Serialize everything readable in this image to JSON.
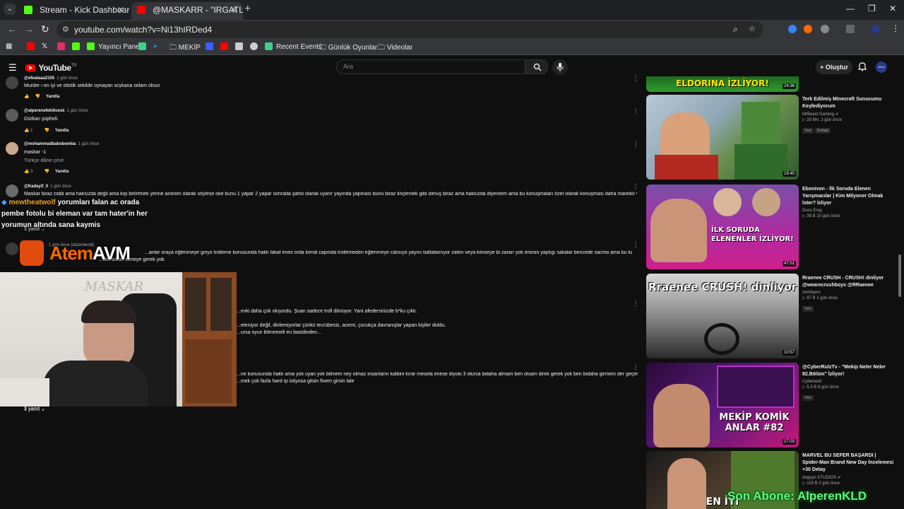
{
  "browser": {
    "tabs": [
      {
        "title": "Stream - Kick Dashboard",
        "active": false,
        "favicon_color": "#53fc18"
      },
      {
        "title": "@MASKARR - \"IRGATLARIN GÜ",
        "active": true,
        "favicon_color": "#ff0000"
      }
    ],
    "url": "youtube.com/watch?v=Ni13hIRDed4",
    "bookmarks": [
      {
        "label": "",
        "icon": "youtube-icon",
        "color": "#ff0000"
      },
      {
        "label": "",
        "icon": "x-icon",
        "color": "#ffffff"
      },
      {
        "label": "",
        "icon": "instagram-icon",
        "color": "#e1306c"
      },
      {
        "label": "Yayıncı Paneli",
        "icon": "kick-icon",
        "color": "#53fc18"
      },
      {
        "label": "",
        "icon": "app-icon",
        "color": "#3ecf8e"
      },
      {
        "label": "",
        "icon": "prime-icon",
        "color": "#3a7bd5"
      },
      {
        "label": "MEKİP",
        "icon": "folder-icon",
        "color": "#aaaaaa"
      },
      {
        "label": "",
        "icon": "bookmark-icon",
        "color": "#3b5cff"
      },
      {
        "label": "",
        "icon": "youtube-icon",
        "color": "#ff0000"
      },
      {
        "label": "",
        "icon": "image-icon",
        "color": "#cccccc"
      },
      {
        "label": "",
        "icon": "circle-icon",
        "color": "#cccccc"
      },
      {
        "label": "Recent Events",
        "icon": "events-icon",
        "color": "#3ecf8e"
      },
      {
        "label": "Günlük Oyunlar",
        "icon": "folder-icon",
        "color": "#aaaaaa"
      },
      {
        "label": "Videolar",
        "icon": "folder-icon",
        "color": "#aaaaaa"
      }
    ]
  },
  "youtube": {
    "logo_text": "YouTube",
    "logo_country": "TR",
    "search_placeholder": "Ara",
    "create_label": "Oluştur",
    "avatar_text": "Ahoo"
  },
  "comments": [
    {
      "handle": "@efeataaa2105",
      "time": "1 gün önce",
      "text": "Murder ı en iyi ve otistik sekilde oynayan scykana selam olsun",
      "likes": "",
      "reply_label": "Yanıtla"
    },
    {
      "handle": "@alperenefekilicesk",
      "time": "1 gün önce",
      "text": "Gürkan şüpheli.",
      "likes": "1",
      "reply_label": "Yanıtla"
    },
    {
      "handle": "@mohammadbabobomba",
      "time": "1 gün önce",
      "text": "maskar -1",
      "text2": "Türkçe diline çevir",
      "likes": "3",
      "reply_label": "Yanıtla"
    },
    {
      "handle": "@Kadayif_0",
      "time": "1 gün önce",
      "text": "Maskar biraz ciddi ama haksızda değil ama kişi belirtmek yerine anonim olarak söylese oke bunu 1 yapar 2 yapar sonrada şahsi olarak uyarır yayında yapması bunu biraz linçlemek gibi olmuş biraz ama haksızda diyemem ama bu konuşmaları özel olarak konuşması daha mantıklı ve",
      "replies": "3 yanıt"
    },
    {
      "handle": "",
      "time": "1 gün önce (düzenlendi)",
      "text": "...anlar oraya eğlenmeye giriyo trolleme konusunda haklı fakat enes orda kendi capında trollemeden eğlenmeye calısıyo yayını baltalamıyor zaten veya kimseye bi zararı yok enesin yaptıgı sakalar bencede sacma ama bu kadar",
      "text2": "...ilini sorun etmeye gerek yok",
      "likes": "10",
      "reply_label": "Yanıtla"
    },
    {
      "handle": "",
      "time": "",
      "text": "...evki daha çok oluyordu. Şuan sadece troll dönüyor. Yani afedersinizde b*ku çıktı.",
      "text2": "...eteniyor değil, dinlemiyorlar çünkü tecrübesiz, acemi, çocukça davranışlar yapan kişiler doldu.",
      "text3": "...ursa oyun bitmemeli en basidinden..."
    },
    {
      "handle": "",
      "time": "",
      "text": "...ne konusunda haklı ama yok uyan yok bilmem ney olmaz insanların kalbini kırar mesela enese diyoki 3 olursa bidaha almam ben olsam direk gerek yok ben bidaha girmem der geçerim",
      "text2": "...mek çok fazla hard rp istiyosa gitsin fivem girsin lale",
      "replies": "3 yanıt"
    }
  ],
  "recommendations": [
    {
      "title": "",
      "channel": "",
      "stats": "",
      "duration": "24:36",
      "thumb_text": "ELDORINA İZLİYOR!"
    },
    {
      "title": "Terk Edilmiş Minecraft Sunucumu Keşfediyorum",
      "channel": "MrBeast Gaming",
      "stats": "28 Mn. 2 gün önce",
      "badges": [
        "Yeni",
        "Dublajlı"
      ],
      "duration": "19:45",
      "thumb_text": ""
    },
    {
      "title": "Ebonivon - İlk Soruda Elenen Yarışmacılar | Kim Milyoner Olmak İster? İzliyor",
      "channel": "Duco Eray",
      "stats": "38 B 10 gün önce",
      "badges": [],
      "duration": "47:01",
      "thumb_text": "İLK SORUDA ELENENLER İZLİYOR!"
    },
    {
      "title": "Rraenee CRUSH - CRUSH! dinliyor @wearecrushboys @RRaenee",
      "channel": "zombyers",
      "stats": "97 B 1 gün önce",
      "badges": [
        "Yeni"
      ],
      "duration": "10:57",
      "thumb_text": "Rraenee CRUSH! dinliyor"
    },
    {
      "title": "@CyberRulzTv - \"Mekip Neler Neler 82.Bölüm\" İzliyor!",
      "channel": "Cyberland",
      "stats": "5,3 B 6 gün önce",
      "badges": [
        "Yeni"
      ],
      "duration": "17:03",
      "thumb_text": "MEKİP KOMİK ANLAR #82"
    },
    {
      "title": "MARVEL BU SEFER BAŞARDI | Spider-Man Brand New Day İncelemesi +30 Detay",
      "channel": "doguyn STUDIOS",
      "stats": "118 B 2 gün önce",
      "badges": [
        "Yeni"
      ],
      "duration": "",
      "thumb_text": "EN İYİ"
    }
  ],
  "overlay": {
    "chat_user": "mewtheatwolf",
    "chat_message_1": "yorumları falan ac orada",
    "chat_message_2": "pembe fotolu bi eleman var tam hater'in her yorumun altında sana kaymis",
    "shop_text_a": "Atem",
    "shop_text_b": "AVM",
    "webcam_sign": "MASKAR",
    "follower_label": "Son Abone:",
    "follower_name": "AlperenKLD"
  }
}
